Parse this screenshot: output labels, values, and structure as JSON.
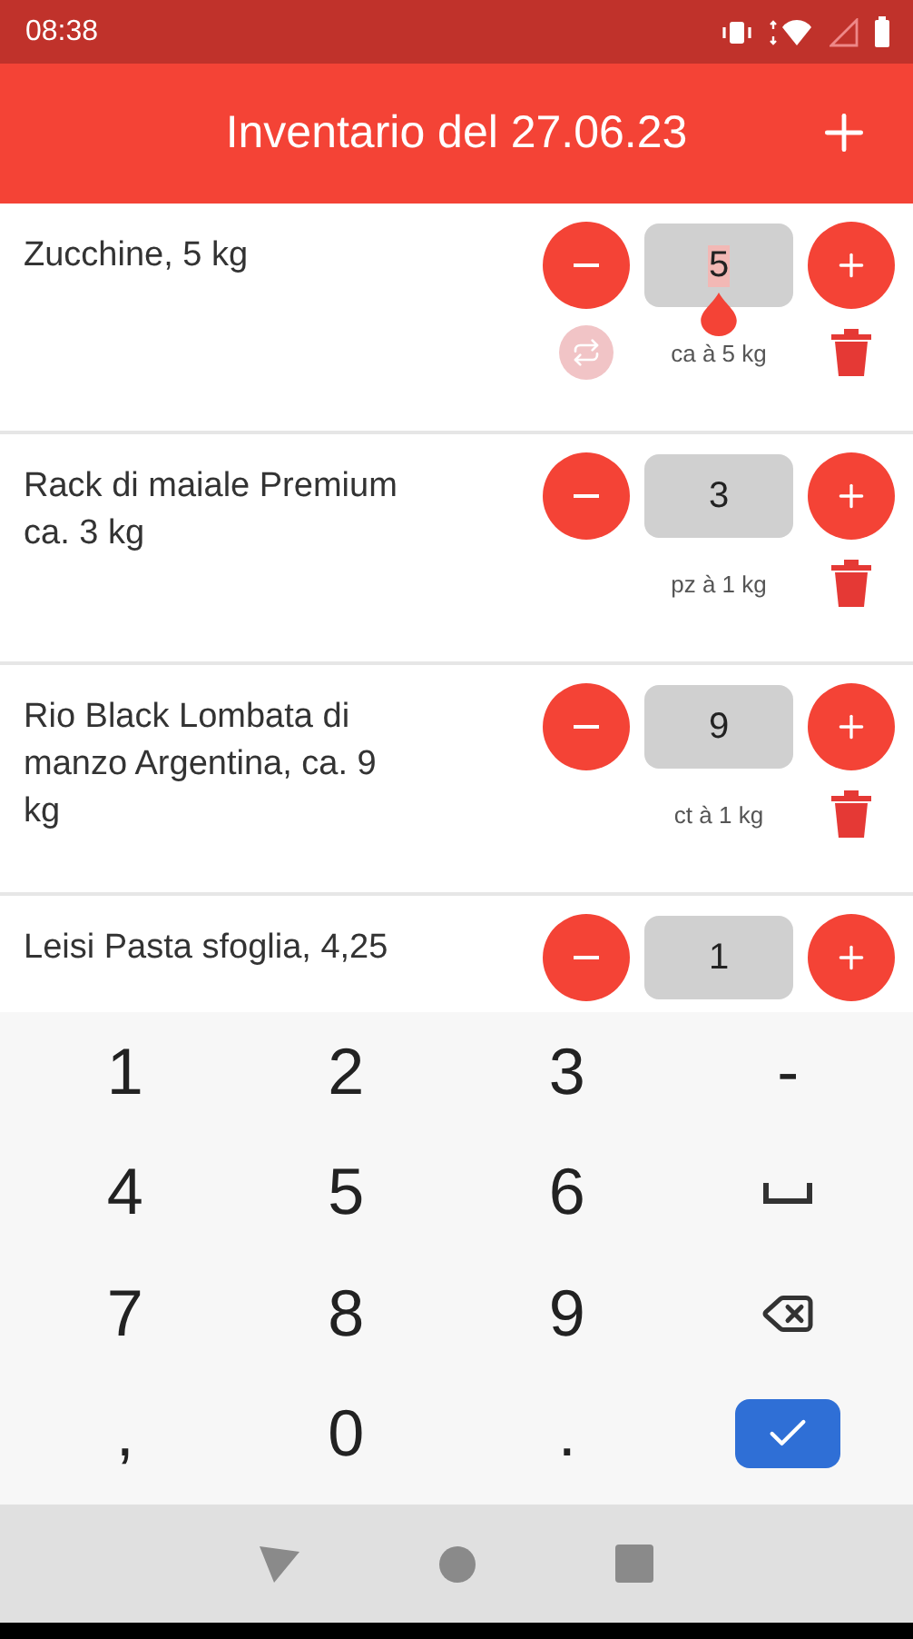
{
  "status_bar": {
    "time": "08:38"
  },
  "header": {
    "title": "Inventario del 27.06.23"
  },
  "items": [
    {
      "name": "Zucchine, 5 kg",
      "quantity": "5",
      "unit": "ca à 5 kg",
      "focused": true,
      "swap_button": true
    },
    {
      "name": "Rack di maiale Premium\nca. 3 kg",
      "quantity": "3",
      "unit": "pz à 1 kg",
      "focused": false,
      "swap_button": false
    },
    {
      "name": "Rio Black Lombata di\nmanzo Argentina, ca. 9\nkg",
      "quantity": "9",
      "unit": "ct à 1 kg",
      "focused": false,
      "swap_button": false
    },
    {
      "name": "Leisi Pasta sfoglia, 4,25",
      "quantity": "1",
      "focused": false,
      "swap_button": false
    }
  ],
  "keyboard": {
    "keys": [
      {
        "kind": "char",
        "label": "1"
      },
      {
        "kind": "char",
        "label": "2"
      },
      {
        "kind": "char",
        "label": "3"
      },
      {
        "kind": "char",
        "label": "-"
      },
      {
        "kind": "char",
        "label": "4"
      },
      {
        "kind": "char",
        "label": "5"
      },
      {
        "kind": "char",
        "label": "6"
      },
      {
        "kind": "space"
      },
      {
        "kind": "char",
        "label": "7"
      },
      {
        "kind": "char",
        "label": "8"
      },
      {
        "kind": "char",
        "label": "9"
      },
      {
        "kind": "backspace"
      },
      {
        "kind": "char",
        "label": ","
      },
      {
        "kind": "char",
        "label": "0"
      },
      {
        "kind": "char",
        "label": "."
      },
      {
        "kind": "done"
      }
    ]
  }
}
